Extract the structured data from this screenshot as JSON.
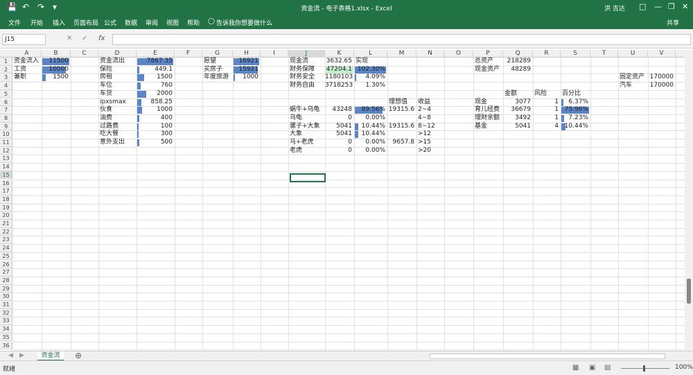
{
  "window": {
    "title": "资金流 - 电子表格1.xlsx - Excel",
    "user": "洪 吉达"
  },
  "ribbon": {
    "tabs": [
      "文件",
      "开始",
      "插入",
      "页面布局",
      "公式",
      "数据",
      "审阅",
      "视图",
      "帮助"
    ],
    "tell_me": "告诉我你想要做什么",
    "share": "共享"
  },
  "formula_bar": {
    "name_box": "J15",
    "fx": "fx"
  },
  "columns": [
    "A",
    "B",
    "C",
    "D",
    "E",
    "F",
    "G",
    "H",
    "I",
    "J",
    "K",
    "L",
    "M",
    "N",
    "O",
    "P",
    "Q",
    "R",
    "S",
    "T",
    "U",
    "V"
  ],
  "rows": [
    "1",
    "2",
    "3",
    "4",
    "5",
    "6",
    "7",
    "8",
    "9",
    "10",
    "11",
    "12",
    "13",
    "14",
    "15",
    "16",
    "17",
    "18",
    "19",
    "20",
    "21",
    "22",
    "23",
    "24",
    "25",
    "26",
    "27",
    "28",
    "29",
    "30",
    "31",
    "32",
    "33",
    "34",
    "35",
    "36"
  ],
  "cells": {
    "a1": "资金流入",
    "b1": "11500",
    "a2": "工资",
    "b2": "10000",
    "a3": "兼职",
    "b3": "1500",
    "d1": "资金流出",
    "e1": "7867.35",
    "d2": "保险",
    "e2": "449.1",
    "d3": "房租",
    "e3": "1500",
    "d4": "车位",
    "e4": "760",
    "d5": "车贷",
    "e5": "2000",
    "d6": "ipxsmax",
    "e6": "858.25",
    "d7": "伙食",
    "e7": "1000",
    "d8": "油费",
    "e8": "400",
    "d9": "过路费",
    "e9": "100",
    "d10": "吃大餐",
    "e10": "300",
    "d11": "意外支出",
    "e11": "500",
    "g1": "愿望",
    "h1": "16921",
    "g2": "买房子",
    "h2": "15921",
    "g3": "年度旅游",
    "h3": "1000",
    "j1": "现金流",
    "k1": "3632.65",
    "l1": "实现",
    "j2": "财务保障",
    "k2": "47204.1",
    "l2": "102.30%",
    "j3": "财务安全",
    "k3": "1180103",
    "l3": "4.09%",
    "j4": "财务自由",
    "k4": "3718253",
    "l4": "1.30%",
    "m6": "理想值",
    "n6": "收益",
    "j7": "蜗牛+乌龟",
    "k7": "43248",
    "l7": "89.56%",
    "m7": "19315.6",
    "n7": "2~4",
    "j8": "乌龟",
    "k8": "0",
    "l8": "0.00%",
    "n8": "4~8",
    "j9": "骡子+大象",
    "k9": "5041",
    "l9": "10.44%",
    "m9": "19315.6",
    "n9": "8~12",
    "j10": "大象",
    "k10": "5041",
    "l10": "10.44%",
    "n10": ">12",
    "j11": "马+老虎",
    "k11": "0",
    "l11": "0.00%",
    "m11": "9657.8",
    "n11": ">15",
    "j12": "老虎",
    "k12": "0",
    "l12": "0.00%",
    "n12": ">20",
    "p1": "总资产",
    "q1": "218289",
    "p2": "现金资产",
    "q2": "48289",
    "q5": "金额",
    "r5": "风险",
    "s5": "百分比",
    "p6": "现金",
    "q6": "3077",
    "r6": "1",
    "s6": "6.37%",
    "p7": "育儿经费",
    "q7": "36679",
    "r7": "1",
    "s7": "75.96%",
    "p8": "理财余额",
    "q8": "3492",
    "r8": "1",
    "s8": "7.23%",
    "p9": "基金",
    "q9": "5041",
    "r9": "4",
    "s9": "10.44%",
    "u3": "固定资产",
    "v3": "170000",
    "u4": "汽车",
    "v4": "170000"
  },
  "data_bars": {
    "b1": 1.0,
    "b2": 0.87,
    "b3": 0.13,
    "e1": 1.0,
    "e2": 0.06,
    "e3": 0.19,
    "e4": 0.1,
    "e5": 0.25,
    "e6": 0.11,
    "e7": 0.13,
    "e8": 0.05,
    "e9": 0.013,
    "e10": 0.04,
    "e11": 0.06,
    "h1": 1.0,
    "h2": 0.94,
    "h3": 0.06,
    "l2": 1.0,
    "l3": 0.04,
    "l7": 0.88,
    "l9": 0.1,
    "l10": 0.1,
    "s6": 0.08,
    "s7": 1.0,
    "s8": 0.095,
    "s9": 0.14
  },
  "sheet_tab": "资金流",
  "status": {
    "ready": "就绪",
    "zoom": "100%"
  },
  "colors": {
    "excel_green": "#217346",
    "bar": "#5b85c5",
    "highlight": "#c6efce"
  }
}
